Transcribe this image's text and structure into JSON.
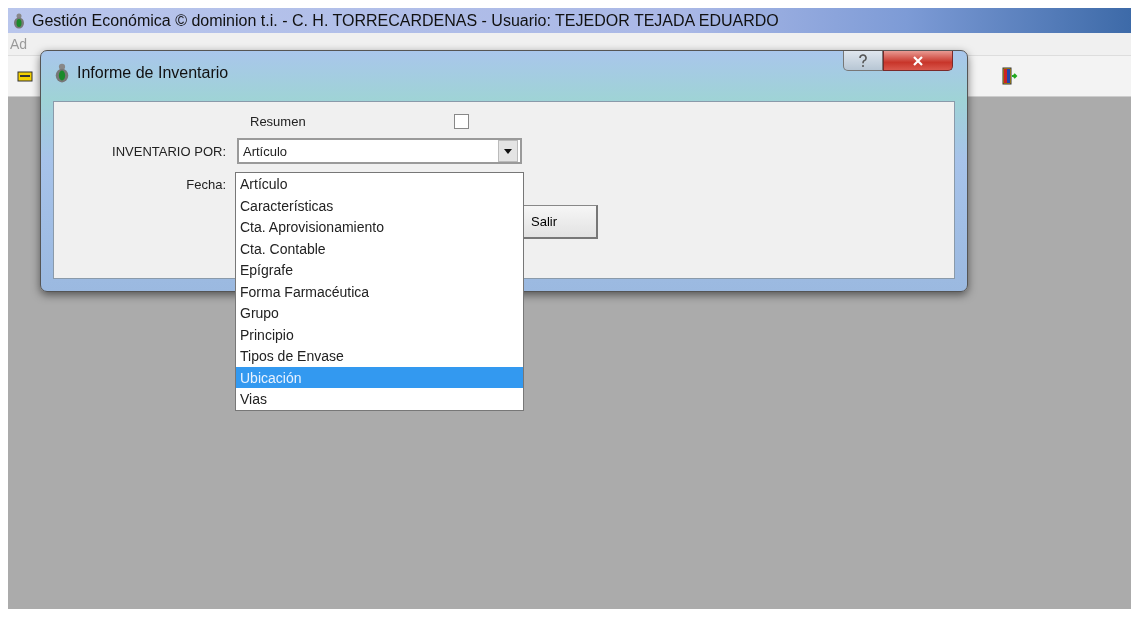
{
  "app": {
    "title": "Gestión Económica © dominion t.i. - C. H. TORRECARDENAS - Usuario: TEJEDOR TEJADA EDUARDO",
    "menu_fragment": "Ad"
  },
  "dialog": {
    "title": "Informe de Inventario",
    "summary": {
      "label": "Resumen",
      "checked": false
    },
    "inventory_by": {
      "label": "INVENTARIO POR:",
      "value": "Artículo",
      "options": [
        {
          "label": "Artículo",
          "highlighted": false
        },
        {
          "label": "Características",
          "highlighted": false
        },
        {
          "label": "Cta. Aprovisionamiento",
          "highlighted": false
        },
        {
          "label": "Cta. Contable",
          "highlighted": false
        },
        {
          "label": "Epígrafe",
          "highlighted": false
        },
        {
          "label": "Forma Farmacéutica",
          "highlighted": false
        },
        {
          "label": "Grupo",
          "highlighted": false
        },
        {
          "label": "Principio",
          "highlighted": false
        },
        {
          "label": "Tipos de Envase",
          "highlighted": false
        },
        {
          "label": "Ubicación",
          "highlighted": true
        },
        {
          "label": "Vias",
          "highlighted": false
        }
      ]
    },
    "date": {
      "label": "Fecha:"
    },
    "buttons": [
      "Salir"
    ]
  }
}
